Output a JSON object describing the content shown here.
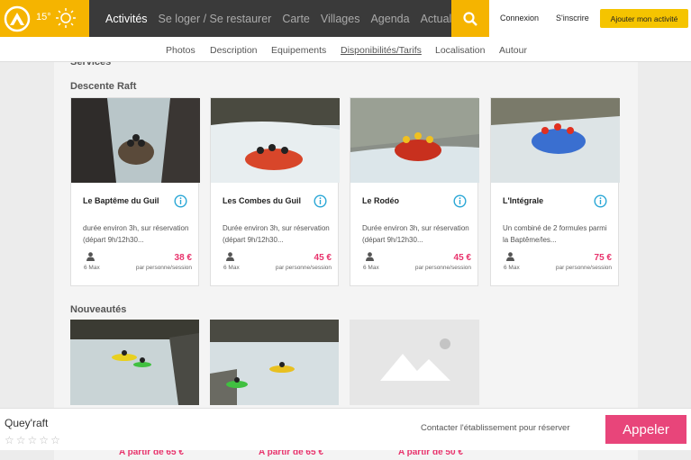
{
  "header": {
    "temperature": "15°",
    "nav": [
      "Activités",
      "Se loger / Se restaurer",
      "Carte",
      "Villages",
      "Agenda",
      "Actualités"
    ],
    "connexion": "Connexion",
    "inscrire": "S'inscrire",
    "ajouter": "Ajouter mon activité",
    "brand_color": "#f5b400"
  },
  "subnav": [
    "Photos",
    "Description",
    "Equipements",
    "Disponibilités/Tarifs",
    "Localisation",
    "Autour"
  ],
  "services_title": "Services",
  "descente": {
    "title": "Descente Raft",
    "cards": [
      {
        "name": "Le Baptême du Guil",
        "desc": "durée environ 3h, sur réservation (départ 9h/12h30...",
        "max": "6 Max",
        "price": "38 €",
        "unit": "par personne/session"
      },
      {
        "name": "Les Combes du Guil",
        "desc": "Durée environ 3h, sur réservation (départ 9h/12h30...",
        "max": "6 Max",
        "price": "45 €",
        "unit": "par personne/session"
      },
      {
        "name": "Le Rodéo",
        "desc": "Durée environ 3h, sur réservation (départ 9h/12h30...",
        "max": "6 Max",
        "price": "45 €",
        "unit": "par personne/session"
      },
      {
        "name": "L'Intégrale",
        "desc": "Un combiné de 2 formules parmi la Baptême/les...",
        "max": "6 Max",
        "price": "75 €",
        "unit": "par personne/session"
      }
    ]
  },
  "nouveautes": {
    "title": "Nouveautés",
    "prices": [
      "A partir de 65 €",
      "A partir de 65 €",
      "A partir de 50 €"
    ]
  },
  "bottom": {
    "place_name": "Quey'raft",
    "stars": [
      "☆",
      "☆",
      "☆",
      "☆",
      "☆"
    ],
    "contact": "Contacter l'établissement pour réserver",
    "call": "Appeler",
    "call_color": "#e8457a"
  }
}
